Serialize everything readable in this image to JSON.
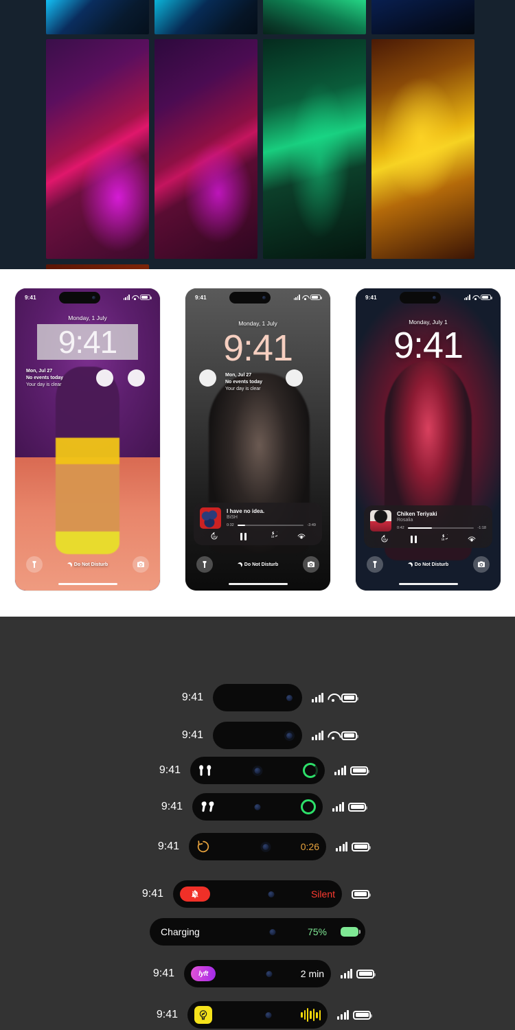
{
  "wallpapers": {
    "row1": [
      {
        "name": "neon-teal-blue-diagonal",
        "swatch": "#14c9ff"
      },
      {
        "name": "neon-teal-navy-diagonal",
        "swatch": "#0bb3d8"
      },
      {
        "name": "neon-mint-green-beam",
        "swatch": "#27dd8a"
      },
      {
        "name": "deep-navy-glow",
        "swatch": "#0b2a6b"
      }
    ],
    "row2": [
      {
        "name": "neon-magenta-purple-pillar",
        "swatch": "#e91ef0"
      },
      {
        "name": "neon-violet-crimson-pillar",
        "swatch": "#d618dc"
      },
      {
        "name": "neon-emerald-arrow",
        "swatch": "#19cd7e"
      },
      {
        "name": "neon-amber-gold-vee",
        "swatch": "#f5d222"
      }
    ],
    "row3": [
      {
        "name": "deep-red-ember",
        "swatch": "#7d2408"
      }
    ]
  },
  "mockups": [
    {
      "id": "phone-purple-fashion",
      "status_bar": {
        "time": "9:41",
        "signal": "cellular-bars-icon",
        "wifi": "wifi-icon",
        "battery": "battery-icon"
      },
      "date": "Monday, 1 July",
      "clock": "9:41",
      "clock_style": "blurred-behind-subject",
      "calendar_widget": {
        "day": "Mon, Jul 27",
        "line1": "No events today",
        "line2": "Your day is clear"
      },
      "circle_widgets": 2,
      "player": null,
      "bottom": {
        "left_icon": "flashlight-icon",
        "focus_label": "Do Not Disturb",
        "right_icon": "camera-icon"
      }
    },
    {
      "id": "phone-dark-portrait",
      "status_bar": {
        "time": "9:41",
        "signal": "cellular-bars-icon",
        "wifi": "wifi-icon",
        "battery": "battery-icon"
      },
      "date": "Monday, 1 July",
      "clock": "9:41",
      "clock_color": "#f6cfc0",
      "calendar_widget": {
        "day": "Mon, Jul 27",
        "line1": "No events today",
        "line2": "Your day is clear"
      },
      "circle_widgets": 2,
      "player": {
        "title": "I have no idea.",
        "artist": "BiSH",
        "elapsed": "0:32",
        "remaining": "-3:49",
        "progress_percent": 12,
        "controls": [
          "skip-back-15-icon",
          "pause-icon",
          "skip-forward-15-icon",
          "airplay-audio-icon"
        ]
      },
      "bottom": {
        "left_icon": "flashlight-icon",
        "focus_label": "Do Not Disturb",
        "right_icon": "camera-icon"
      }
    },
    {
      "id": "phone-red-street",
      "status_bar": {
        "time": "9:41",
        "signal": "cellular-bars-icon",
        "wifi": "wifi-icon",
        "battery": "battery-icon"
      },
      "date": "Monday, July 1",
      "clock": "9:41",
      "clock_color": "#ffffff",
      "player": {
        "title": "Chiken Teriyaki",
        "artist": "Rosalia",
        "elapsed": "0:42",
        "remaining": "-1:18",
        "progress_percent": 36,
        "controls": [
          "skip-back-15-icon",
          "pause-icon",
          "skip-forward-15-icon",
          "airplay-audio-icon"
        ]
      },
      "bottom": {
        "left_icon": "flashlight-icon",
        "focus_label": "Do Not Disturb",
        "right_icon": "camera-icon"
      }
    }
  ],
  "dynamic_island_rows": [
    {
      "id": "idle-compact",
      "time": "9:41",
      "pill_width": 130,
      "leading_icon": null,
      "trailing_label": null,
      "trailing_color": null,
      "status_icons": [
        "cellular-bars-icon",
        "wifi-icon",
        "battery-icon"
      ]
    },
    {
      "id": "idle-faceid",
      "time": "9:41",
      "pill_width": 130,
      "leading_icon": null,
      "trailing_label": null,
      "trailing_color": null,
      "status_icons": [
        "cellular-bars-icon",
        "wifi-icon",
        "battery-icon"
      ]
    },
    {
      "id": "airpods-pro-connected",
      "time": "9:41",
      "pill_width": 196,
      "leading_icon": "airpods-pro-icon",
      "trailing_label": null,
      "trailing_icon": "charge-ring-icon",
      "trailing_color": "#2de06a",
      "status_icons": [
        "cellular-bars-icon",
        "battery-icon"
      ]
    },
    {
      "id": "airpods-connected",
      "time": "9:41",
      "pill_width": 190,
      "leading_icon": "airpods-icon",
      "trailing_label": null,
      "trailing_icon": "charge-ring-icon",
      "trailing_color": "#2de06a",
      "status_icons": [
        "cellular-bars-icon",
        "battery-icon"
      ]
    },
    {
      "id": "timer-running",
      "time": "9:41",
      "pill_width": 200,
      "leading_icon": "timer-icon",
      "trailing_label": "0:26",
      "trailing_color": "#e8a33d",
      "status_icons": [
        "cellular-bars-icon",
        "battery-icon"
      ]
    },
    {
      "id": "silent-mode",
      "time": "9:41",
      "pill_width": 246,
      "leading_icon": "bell-slash-icon",
      "trailing_label": "Silent",
      "trailing_color": "#ff3b30",
      "status_icons": [
        "battery-icon"
      ]
    },
    {
      "id": "charging",
      "time": "",
      "pill_width": 314,
      "leading_label": "Charging",
      "trailing_label": "75%",
      "trailing_icon": "battery-charging-icon",
      "trailing_color": "#7fe894",
      "status_icons": []
    },
    {
      "id": "lyft-eta",
      "time": "9:41",
      "pill_width": 214,
      "leading_icon": "lyft-icon",
      "leading_brand": "lyft",
      "trailing_label": "2 min",
      "trailing_color": "#ffffff",
      "status_icons": [
        "cellular-bars-icon",
        "battery-icon"
      ]
    },
    {
      "id": "shazam-listening",
      "time": "9:41",
      "pill_width": 204,
      "leading_icon": "shazam-icon",
      "trailing_icon": "waveform-icon",
      "trailing_label": null,
      "trailing_color": "#f5d90a",
      "status_icons": [
        "cellular-bars-icon",
        "battery-icon"
      ]
    }
  ],
  "colors": {
    "section_top_bg": "#16222e",
    "section_mock_bg": "#ffffff",
    "section_island_bg": "#333333",
    "island_fill": "#0a0a0a",
    "green": "#2de06a",
    "orange": "#e8a33d",
    "red": "#ff3b30",
    "yellow": "#f5d90a"
  }
}
